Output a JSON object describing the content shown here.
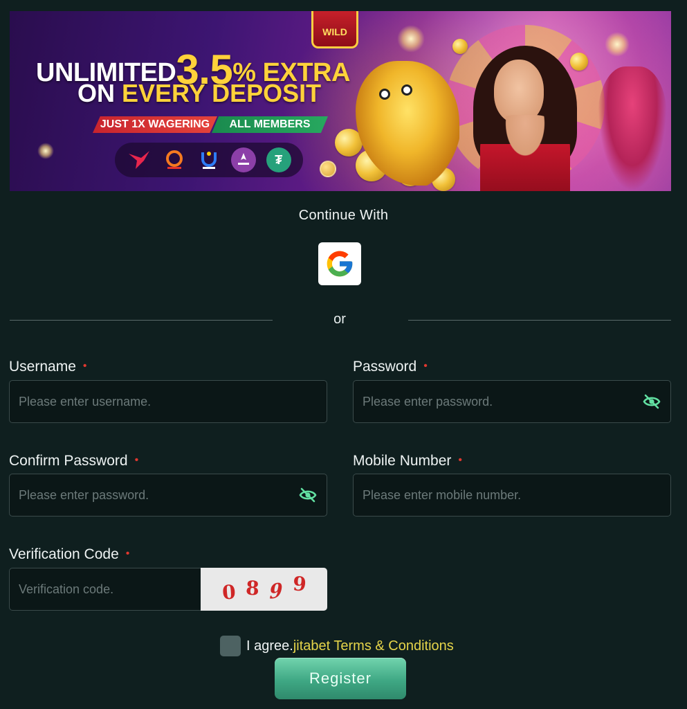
{
  "banner": {
    "line1_prefix": "UNLIMITED",
    "line1_big": "3.5",
    "line1_suffix": "% EXTRA",
    "line2_prefix": "ON ",
    "line2_gold": "EVERY DEPOSIT",
    "tag_red": "JUST 1X WAGERING",
    "tag_green": "ALL MEMBERS",
    "wild_label": "WILD",
    "payment_icons": [
      "bird-icon",
      "nagad-icon",
      "upay-icon",
      "rocket-icon",
      "usdt-icon"
    ],
    "usdt_symbol": "₮"
  },
  "social": {
    "continue_label": "Continue With",
    "google_icon": "google-icon"
  },
  "divider": {
    "or_label": "or"
  },
  "form": {
    "username": {
      "label": "Username",
      "placeholder": "Please enter username."
    },
    "password": {
      "label": "Password",
      "placeholder": "Please enter password."
    },
    "confirm_password": {
      "label": "Confirm Password",
      "placeholder": "Please enter password."
    },
    "mobile": {
      "label": "Mobile Number",
      "placeholder": "Please enter mobile number."
    },
    "verification": {
      "label": "Verification Code",
      "placeholder": "Verification code.",
      "captcha": [
        "0",
        "8",
        "9",
        "9"
      ]
    },
    "required_mark": "•"
  },
  "agree": {
    "text": "I agree.",
    "link": "jitabet Terms & Conditions"
  },
  "register": {
    "label": "Register"
  },
  "colors": {
    "background": "#0f1f1f",
    "accent": "#3fa884",
    "link": "#e6d54a",
    "required": "#e0382f"
  }
}
